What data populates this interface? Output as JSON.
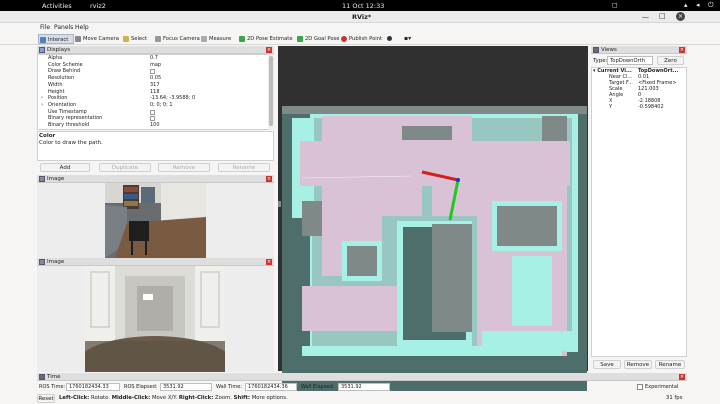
{
  "topbar": {
    "activities": "Activities",
    "app": "rviz2",
    "clock": "11 Oct  12:33"
  },
  "window": {
    "title": "RViz*"
  },
  "menu": [
    "File",
    "Panels",
    "Help"
  ],
  "toolbar": [
    "Interact",
    "Move Camera",
    "Select",
    "Focus Camera",
    "Measure",
    "2D Pose Estimate",
    "2D Goal Pose",
    "Publish Point"
  ],
  "displays": {
    "title": "Displays",
    "props": [
      {
        "k": "Alpha",
        "v": "0.7"
      },
      {
        "k": "Color Scheme",
        "v": "map"
      },
      {
        "k": "Draw Behind",
        "v": ""
      },
      {
        "k": "Resolution",
        "v": "0.05"
      },
      {
        "k": "Width",
        "v": "317"
      },
      {
        "k": "Height",
        "v": "118"
      },
      {
        "k": "Position",
        "v": "-13.64; -3.9588; 0"
      },
      {
        "k": "Orientation",
        "v": "0; 0; 0; 1"
      },
      {
        "k": "Use Timestamp",
        "v": ""
      },
      {
        "k": "Binary representation",
        "v": ""
      },
      {
        "k": "Binary threshold",
        "v": "100"
      }
    ],
    "desc_title": "Color",
    "desc_text": "Color to draw the path.",
    "buttons": [
      "Add",
      "Duplicate",
      "Remove",
      "Rename"
    ]
  },
  "image1": {
    "title": "Image"
  },
  "image2": {
    "title": "Image"
  },
  "views": {
    "title": "Views",
    "type_label": "Type:",
    "type_value": "TopDownOrth",
    "zero": "Zero",
    "current_label": "Current Vi...",
    "current_value": "TopDownOrt...",
    "props": [
      {
        "k": "Near Cl...",
        "v": "0.01"
      },
      {
        "k": "Target F...",
        "v": "<Fixed Frame>"
      },
      {
        "k": "Scale",
        "v": "121.003"
      },
      {
        "k": "Angle",
        "v": "0"
      },
      {
        "k": "X",
        "v": "-2.18808"
      },
      {
        "k": "Y",
        "v": "-0.598402"
      }
    ],
    "buttons": [
      "Save",
      "Remove",
      "Rename"
    ]
  },
  "time": {
    "title": "Time",
    "ros_time_label": "ROS Time:",
    "ros_time": "1760182434.33",
    "ros_elapsed_label": "ROS Elapsed:",
    "ros_elapsed": "3531.92",
    "wall_time_label": "Wall Time:",
    "wall_time": "1760182434.36",
    "wall_elapsed_label": "Wall Elapsed:",
    "wall_elapsed": "3531.92",
    "experimental": "Experimental"
  },
  "status": {
    "reset": "Reset",
    "hint_lc": "Left-Click:",
    "hint_lc_t": "Rotate.",
    "hint_mc": "Middle-Click:",
    "hint_mc_t": "Move X/Y.",
    "hint_rc": "Right-Click:",
    "hint_rc_t": "Zoom.",
    "hint_sh": "Shift:",
    "hint_sh_t": "More options.",
    "fps": "31 fps"
  },
  "colors": {
    "map_bg": "#4d6e6b",
    "free": "#d9c1d6",
    "inflation": "#a7f0e6",
    "unknown": "#7f8a88",
    "axis_x": "#d22020",
    "axis_y": "#1ec81e"
  }
}
